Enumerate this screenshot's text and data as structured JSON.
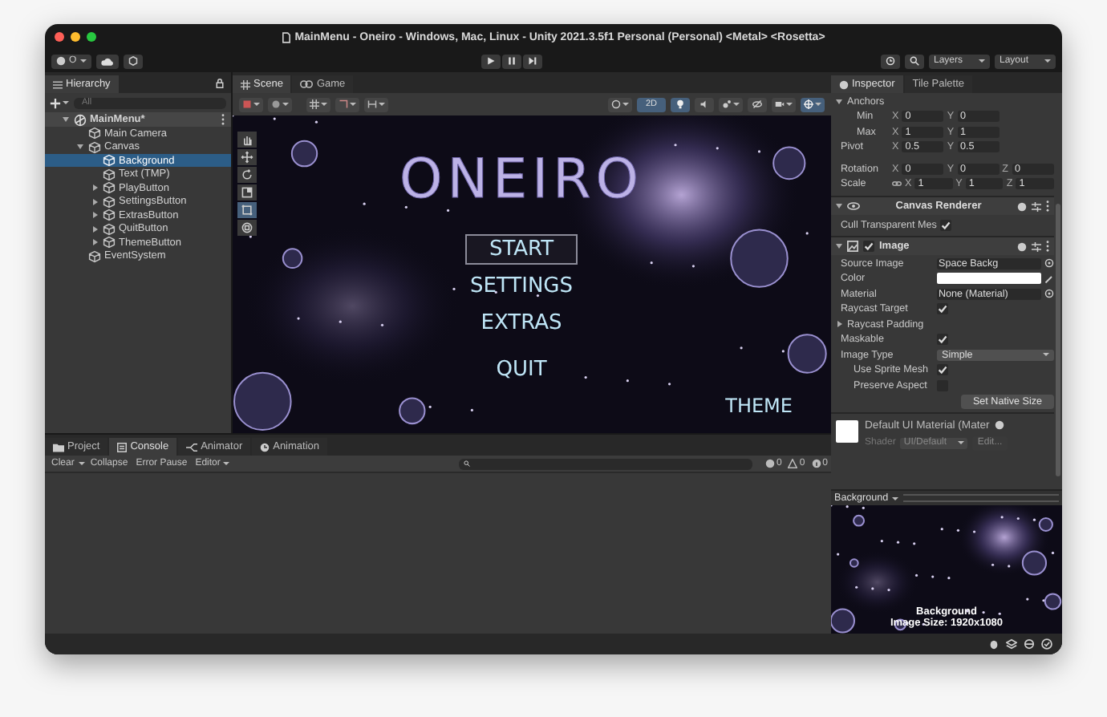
{
  "window": {
    "title": "MainMenu - Oneiro - Windows, Mac, Linux - Unity 2021.3.5f1 Personal (Personal) <Metal> <Rosetta>"
  },
  "toolbar": {
    "account": "O",
    "layers": "Layers",
    "layout": "Layout"
  },
  "hierarchy": {
    "title": "Hierarchy",
    "search_placeholder": "All",
    "items": [
      {
        "label": "MainMenu*",
        "kind": "scene",
        "expanded": true,
        "selected": false,
        "children": [
          {
            "label": "Main Camera",
            "kind": "object",
            "selected": false
          },
          {
            "label": "Canvas",
            "kind": "group",
            "expanded": true,
            "selected": false,
            "children": [
              {
                "label": "Background",
                "kind": "object",
                "selected": true
              },
              {
                "label": "Text (TMP)",
                "kind": "object",
                "selected": false
              },
              {
                "label": "PlayButton",
                "kind": "group",
                "expanded": false,
                "selected": false
              },
              {
                "label": "SettingsButton",
                "kind": "group",
                "expanded": false,
                "selected": false
              },
              {
                "label": "ExtrasButton",
                "kind": "group",
                "expanded": false,
                "selected": false
              },
              {
                "label": "QuitButton",
                "kind": "group",
                "expanded": false,
                "selected": false
              },
              {
                "label": "ThemeButton",
                "kind": "group",
                "expanded": false,
                "selected": false
              }
            ]
          },
          {
            "label": "EventSystem",
            "kind": "object",
            "selected": false
          }
        ]
      }
    ]
  },
  "scene_view": {
    "tabs": [
      {
        "label": "Scene",
        "kind": "scene",
        "selected": true
      },
      {
        "label": "Game",
        "kind": "game",
        "selected": false
      }
    ],
    "mode_2d": {
      "label": "2D",
      "on": true
    },
    "lighting_on": true,
    "tools": [
      {
        "kind": "hand",
        "selected": false
      },
      {
        "kind": "move",
        "selected": false
      },
      {
        "kind": "rotate",
        "selected": false
      },
      {
        "kind": "scale",
        "selected": false
      },
      {
        "kind": "rect",
        "selected": true
      },
      {
        "kind": "transform",
        "selected": false
      }
    ],
    "game": {
      "title": "ONEIRO",
      "menu": [
        {
          "label": "START",
          "selected": true
        },
        {
          "label": "SETTINGS",
          "selected": false
        },
        {
          "label": "EXTRAS",
          "selected": false
        },
        {
          "label": "QUIT",
          "selected": false
        }
      ],
      "corner_button": "THEME"
    }
  },
  "console": {
    "tabs": [
      {
        "label": "Project",
        "kind": "project",
        "selected": false
      },
      {
        "label": "Console",
        "kind": "console",
        "selected": true
      },
      {
        "label": "Animator",
        "kind": "animator",
        "selected": false
      },
      {
        "label": "Animation",
        "kind": "animation",
        "selected": false
      }
    ],
    "toolbar": {
      "clear": "Clear",
      "collapse": "Collapse",
      "error_pause": "Error Pause",
      "editor": "Editor"
    },
    "counts": [
      {
        "kind": "error",
        "value": "0"
      },
      {
        "kind": "warning",
        "value": "0"
      },
      {
        "kind": "info",
        "value": "0"
      }
    ]
  },
  "inspector": {
    "tabs": [
      {
        "label": "Inspector",
        "selected": true
      },
      {
        "label": "Tile Palette",
        "selected": false
      }
    ],
    "anchors": {
      "label": "Anchors",
      "expanded": true
    },
    "transform_rows": [
      {
        "label": "Min",
        "indented": true,
        "constrained": false,
        "fields": [
          {
            "axis": "X",
            "value": "0"
          },
          {
            "axis": "Y",
            "value": "0"
          }
        ]
      },
      {
        "label": "Max",
        "indented": true,
        "constrained": false,
        "fields": [
          {
            "axis": "X",
            "value": "1"
          },
          {
            "axis": "Y",
            "value": "1"
          }
        ]
      },
      {
        "label": "Pivot",
        "indented": false,
        "constrained": false,
        "fields": [
          {
            "axis": "X",
            "value": "0.5"
          },
          {
            "axis": "Y",
            "value": "0.5"
          }
        ]
      },
      {
        "label": "Rotation",
        "indented": false,
        "constrained": false,
        "fields": [
          {
            "axis": "X",
            "value": "0"
          },
          {
            "axis": "Y",
            "value": "0"
          },
          {
            "axis": "Z",
            "value": "0"
          }
        ]
      },
      {
        "label": "Scale",
        "indented": false,
        "constrained": true,
        "fields": [
          {
            "axis": "X",
            "value": "1"
          },
          {
            "axis": "Y",
            "value": "1"
          },
          {
            "axis": "Z",
            "value": "1"
          }
        ]
      }
    ],
    "canvas_renderer": {
      "title": "Canvas Renderer",
      "expanded": true,
      "cull_label": "Cull Transparent Mes",
      "cull_checked": true
    },
    "image_component": {
      "title": "Image",
      "expanded": true,
      "enabled": true,
      "fields": [
        {
          "label": "Source Image",
          "kind": "object",
          "value": "Space Backg",
          "indented": false
        },
        {
          "label": "Color",
          "kind": "color",
          "indented": false
        },
        {
          "label": "Material",
          "kind": "object",
          "value": "None (Material)",
          "indented": false
        },
        {
          "label": "Raycast Target",
          "kind": "checkbox",
          "checked": true,
          "indented": false
        },
        {
          "label": "Raycast Padding",
          "kind": "foldout",
          "expanded": false,
          "indented": false
        },
        {
          "label": "Maskable",
          "kind": "checkbox",
          "checked": true,
          "indented": false
        },
        {
          "label": "Image Type",
          "kind": "dropdown",
          "value": "Simple",
          "indented": false
        },
        {
          "label": "Use Sprite Mesh",
          "kind": "checkbox",
          "checked": true,
          "indented": true
        },
        {
          "label": "Preserve Aspect",
          "kind": "checkbox",
          "checked": false,
          "indented": true
        },
        {
          "label": "Set Native Size",
          "kind": "button"
        }
      ]
    },
    "material": {
      "name": "Default UI Material (Mater",
      "shader_label": "Shader",
      "shader": "UI/Default",
      "edit": "Edit..."
    },
    "preview": {
      "title": "Background",
      "caption": "Background",
      "size": "Image Size: 1920x1080"
    }
  }
}
